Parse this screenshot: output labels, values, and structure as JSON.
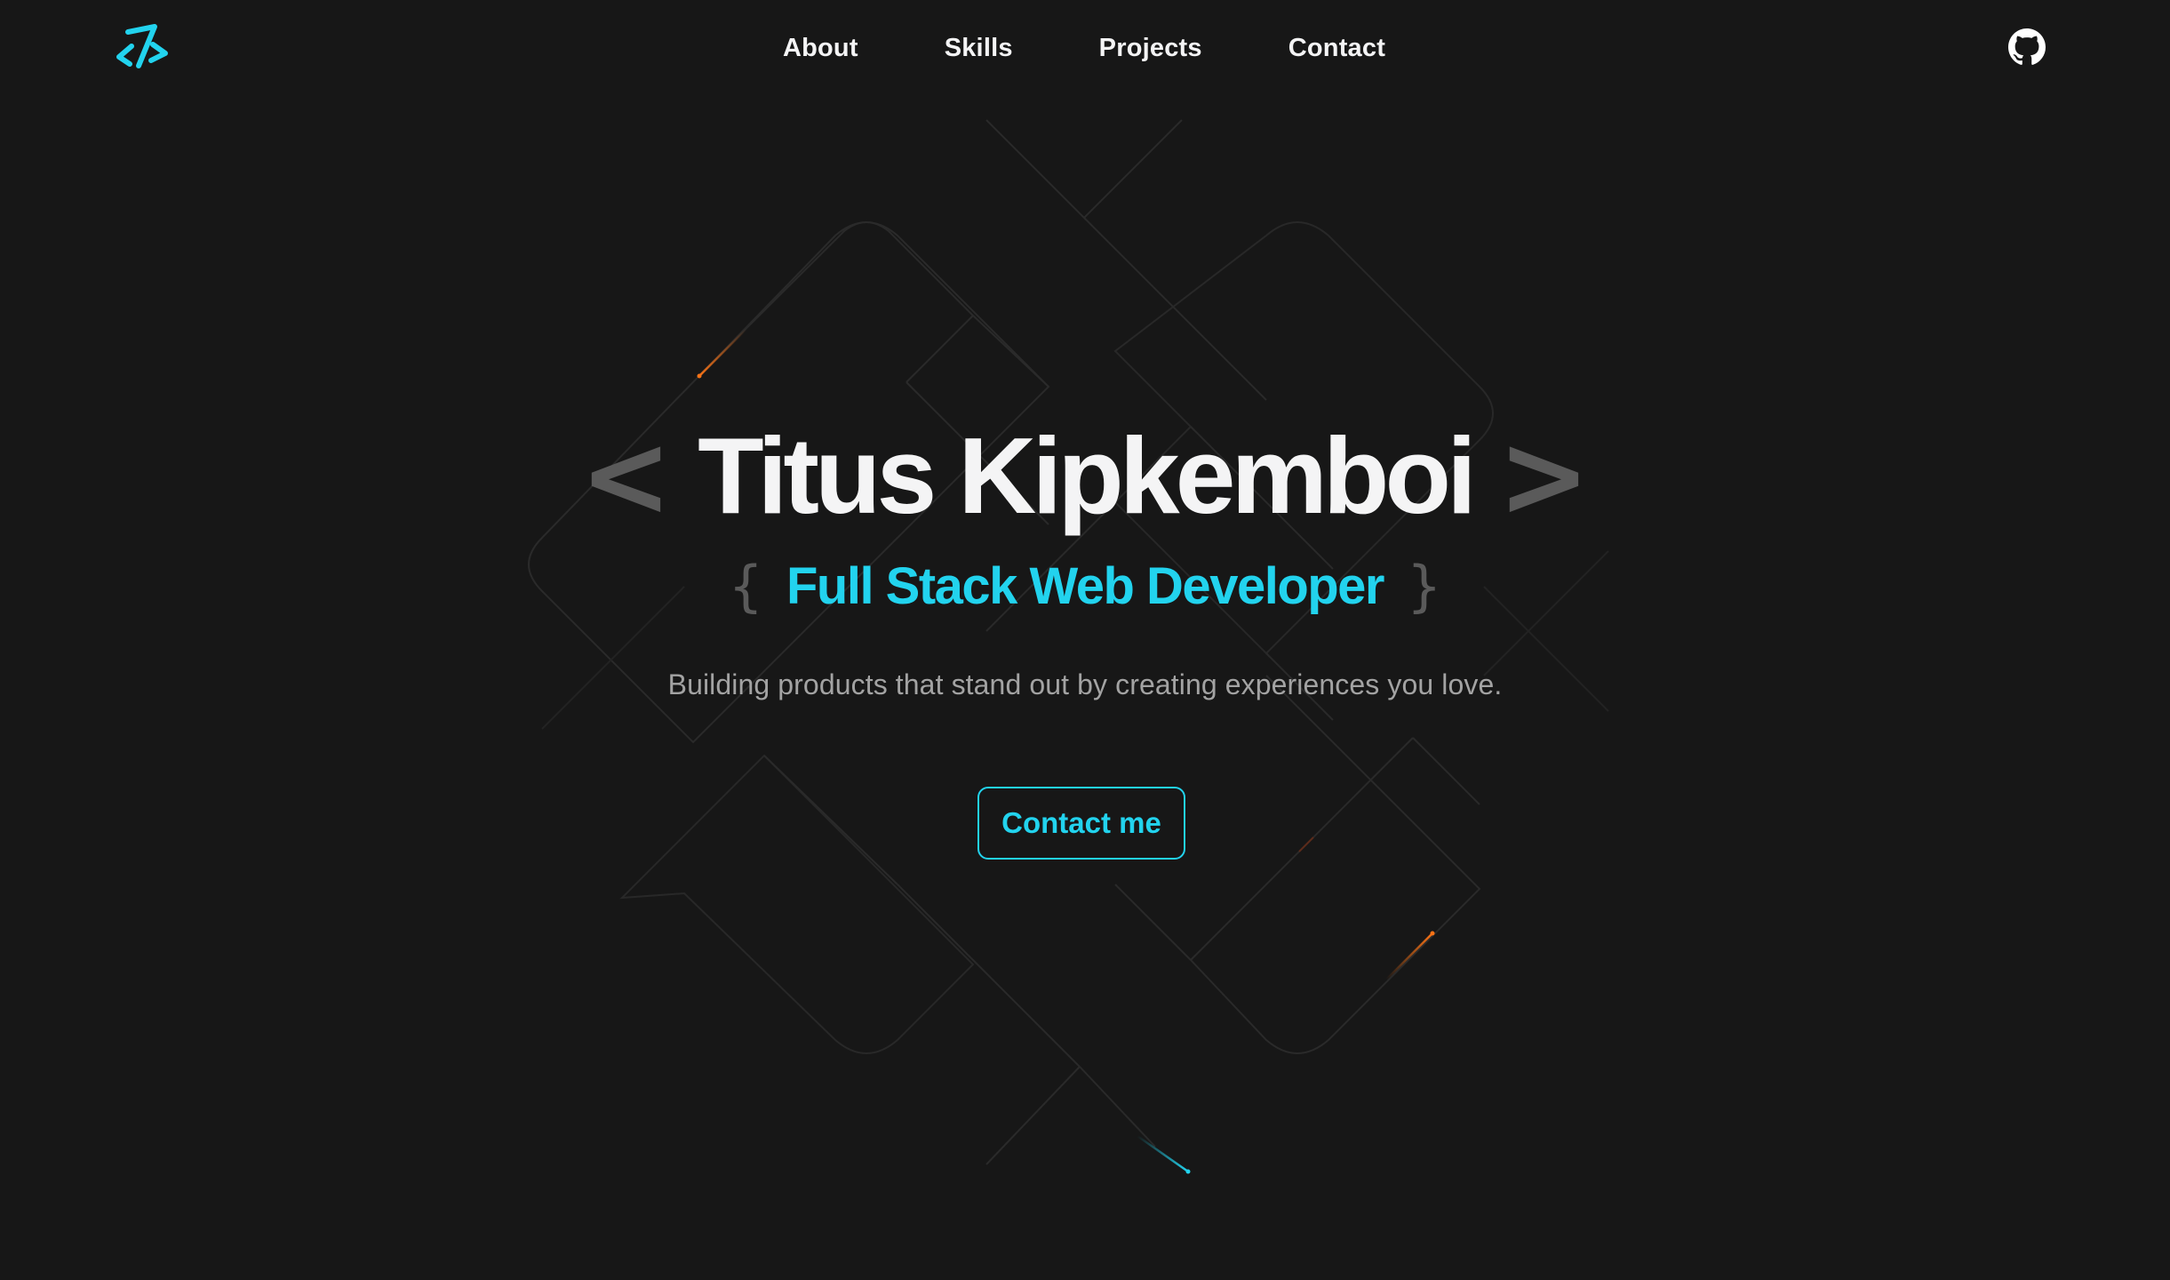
{
  "header": {
    "logo_icon": "code-brackets-logo-icon",
    "nav": [
      {
        "label": "About"
      },
      {
        "label": "Skills"
      },
      {
        "label": "Projects"
      },
      {
        "label": "Contact"
      }
    ],
    "github_icon": "github-icon"
  },
  "hero": {
    "open_angle": "<",
    "name": "Titus Kipkemboi",
    "close_angle": ">",
    "open_brace": "{",
    "role": "Full Stack Web Developer",
    "close_brace": "}",
    "tagline": "Building products that stand out by creating experiences you love.",
    "cta_label": "Contact me"
  },
  "colors": {
    "background": "#171717",
    "accent": "#22d3ee",
    "text_primary": "#f4f4f5",
    "text_muted": "#a3a3a3",
    "bracket": "#5a5a5a",
    "spark_orange": "#f97316"
  }
}
